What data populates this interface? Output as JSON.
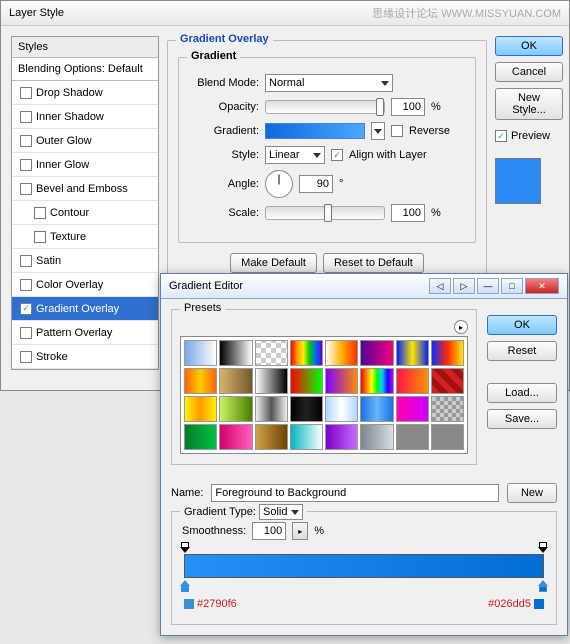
{
  "layerStyle": {
    "title": "Layer Style",
    "watermark": "思缘设计论坛    WWW.MISSYUAN.COM",
    "stylesHeader": "Styles",
    "blendingDefault": "Blending Options: Default",
    "items": [
      {
        "label": "Drop Shadow",
        "checked": false,
        "sub": false
      },
      {
        "label": "Inner Shadow",
        "checked": false,
        "sub": false
      },
      {
        "label": "Outer Glow",
        "checked": false,
        "sub": false
      },
      {
        "label": "Inner Glow",
        "checked": false,
        "sub": false
      },
      {
        "label": "Bevel and Emboss",
        "checked": false,
        "sub": false
      },
      {
        "label": "Contour",
        "checked": false,
        "sub": true
      },
      {
        "label": "Texture",
        "checked": false,
        "sub": true
      },
      {
        "label": "Satin",
        "checked": false,
        "sub": false
      },
      {
        "label": "Color Overlay",
        "checked": false,
        "sub": false
      },
      {
        "label": "Gradient Overlay",
        "checked": true,
        "sub": false,
        "selected": true
      },
      {
        "label": "Pattern Overlay",
        "checked": false,
        "sub": false
      },
      {
        "label": "Stroke",
        "checked": false,
        "sub": false
      }
    ],
    "panel": {
      "mainLegend": "Gradient Overlay",
      "innerLegend": "Gradient",
      "blendModeLabel": "Blend Mode:",
      "blendMode": "Normal",
      "opacityLabel": "Opacity:",
      "opacity": "100",
      "pct": "%",
      "gradientLabel": "Gradient:",
      "reverseLabel": "Reverse",
      "reverseChecked": false,
      "styleLabel": "Style:",
      "style": "Linear",
      "alignLabel": "Align with Layer",
      "alignChecked": true,
      "angleLabel": "Angle:",
      "angle": "90",
      "deg": "°",
      "scaleLabel": "Scale:",
      "scale": "100",
      "makeDefault": "Make Default",
      "resetDefault": "Reset to Default"
    },
    "buttons": {
      "ok": "OK",
      "cancel": "Cancel",
      "newStyle": "New Style...",
      "preview": "Preview",
      "previewChecked": true
    }
  },
  "gradientEditor": {
    "title": "Gradient Editor",
    "presetsLabel": "Presets",
    "presets": [
      "linear-gradient(90deg,#7aa8e8,#fff)",
      "linear-gradient(90deg,#000,#fff)",
      "repeating-conic-gradient(#ccc 0 25%,#fff 0 50%) 0/10px 10px",
      "linear-gradient(90deg,#ff0000,#ff9900,#ffee00,#00cc00,#0066ff,#6600cc)",
      "linear-gradient(90deg,#fff,#ffb000,#ff3000)",
      "linear-gradient(90deg,#540099,#ef017c)",
      "linear-gradient(90deg,#0022ff,#ffe600,#0022ff)",
      "linear-gradient(90deg,#0a30ff,#ff2a00,#ffe600)",
      "linear-gradient(90deg,#ff6600,#ffcc00,#ff6600)",
      "linear-gradient(90deg,#d9b36c,#735a2e)",
      "linear-gradient(90deg,#fff,#000)",
      "linear-gradient(90deg,#ff0000,#00ff00)",
      "linear-gradient(90deg,#7f00ff,#ff8a00)",
      "linear-gradient(90deg,#ff0000,#ff7f00,#ffff00,#00ff00,#00cfff,#1e00ff,#b400ff)",
      "linear-gradient(90deg,#ff1744,#ff9100)",
      "repeating-linear-gradient(45deg,#d02020 0 6px,#a01010 6px 12px)",
      "linear-gradient(90deg,#fff200,#ff9900,#fff200)",
      "linear-gradient(90deg,#c9f364,#4a7d00)",
      "linear-gradient(90deg,#eee,#555,#eee)",
      "linear-gradient(90deg,#000,#222,#000)",
      "linear-gradient(90deg,#b0d8ff,#ffffff,#b0d8ff)",
      "linear-gradient(90deg,#1f6fe0,#65b7ff,#1f6fe0)",
      "linear-gradient(90deg,#ff00aa,#cc00ff)",
      "repeating-conic-gradient(#999 0 25%,#ccc 0 50%) 0/8px 8px",
      "linear-gradient(90deg,#007d2a,#00c043)",
      "linear-gradient(90deg,#d4006a,#ff5ec1)",
      "linear-gradient(90deg,#cfa14a,#6e4500)",
      "linear-gradient(90deg,#00b7c2,#ffffff)",
      "linear-gradient(90deg,#7a00c8,#c86bff)",
      "linear-gradient(90deg,#7a868f,#d8dde1)",
      "#888",
      "#888"
    ],
    "buttons": {
      "ok": "OK",
      "reset": "Reset",
      "load": "Load...",
      "save": "Save..."
    },
    "nameLabel": "Name:",
    "name": "Foreground to Background",
    "new": "New",
    "gradientTypeLabel": "Gradient Type:",
    "gradientType": "Solid",
    "smoothnessLabel": "Smoothness:",
    "smoothness": "100",
    "pct": "%",
    "hexLeft": "#2790f6",
    "hexRight": "#026dd5"
  }
}
